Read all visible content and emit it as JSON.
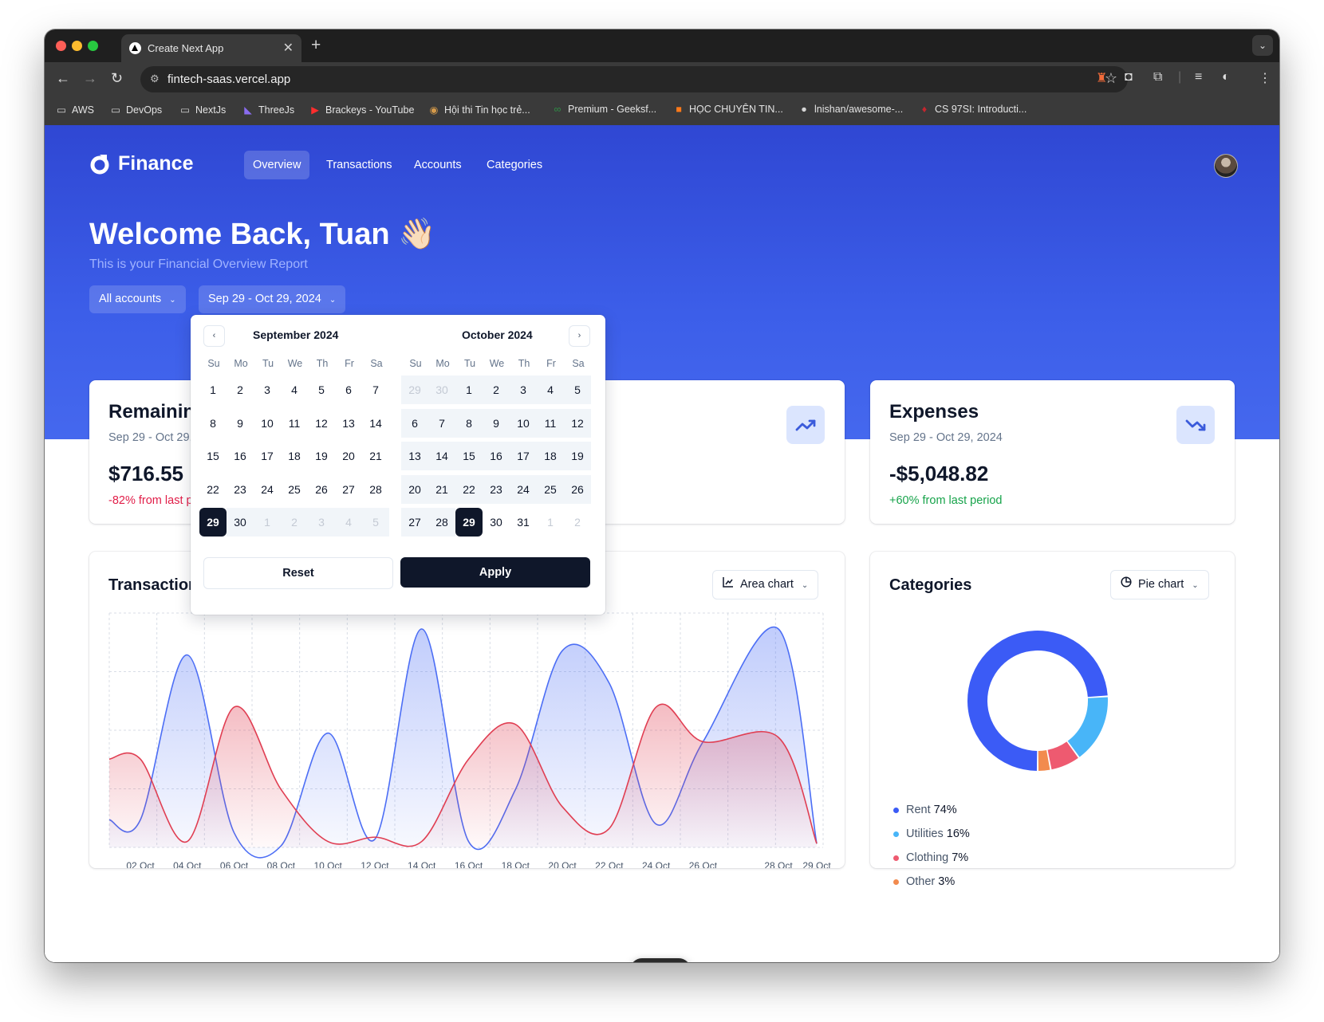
{
  "browser": {
    "tab_title": "Create Next App",
    "new_tab": "+",
    "url": "fintech-saas.vercel.app",
    "bookmarks": [
      "AWS",
      "DevOps",
      "NextJs",
      "ThreeJs",
      "Brackeys - YouTube",
      "Hội thi Tin học trẻ...",
      "Premium - Geeksf...",
      "HỌC CHUYÊN TIN...",
      "lnishan/awesome-...",
      "CS 97SI: Introducti..."
    ]
  },
  "header": {
    "logo": "Finance",
    "nav": [
      "Overview",
      "Transactions",
      "Accounts",
      "Categories"
    ],
    "active_nav": "Overview"
  },
  "hero": {
    "welcome": "Welcome Back, Tuan 👋🏻",
    "subtitle": "This is your Financial Overview Report",
    "account_filter": "All accounts",
    "date_filter": "Sep 29 - Oct 29, 2024"
  },
  "cards": {
    "remaining": {
      "title": "Remaining",
      "period": "Sep 29 - Oct 29, 2024",
      "amount": "$716.55",
      "change": "-82% from last period",
      "change_color": "#e11d48"
    },
    "expenses": {
      "title": "Expenses",
      "period": "Sep 29 - Oct 29, 2024",
      "amount": "-$5,048.82",
      "change": "+60% from last period",
      "change_color": "#16a34a"
    }
  },
  "transactions": {
    "title": "Transactions",
    "chart_select": "Area chart"
  },
  "categories_panel": {
    "title": "Categories",
    "chart_select": "Pie chart"
  },
  "calendar": {
    "month1": "September 2024",
    "month2": "October 2024",
    "weekdays": [
      "Su",
      "Mo",
      "Tu",
      "We",
      "Th",
      "Fr",
      "Sa"
    ],
    "reset": "Reset",
    "apply": "Apply",
    "sep_grid": [
      [
        "1",
        "2",
        "3",
        "4",
        "5",
        "6",
        "7"
      ],
      [
        "8",
        "9",
        "10",
        "11",
        "12",
        "13",
        "14"
      ],
      [
        "15",
        "16",
        "17",
        "18",
        "19",
        "20",
        "21"
      ],
      [
        "22",
        "23",
        "24",
        "25",
        "26",
        "27",
        "28"
      ],
      [
        "29",
        "30",
        "1",
        "2",
        "3",
        "4",
        "5"
      ]
    ],
    "oct_grid": [
      [
        "29",
        "30",
        "1",
        "2",
        "3",
        "4",
        "5"
      ],
      [
        "6",
        "7",
        "8",
        "9",
        "10",
        "11",
        "12"
      ],
      [
        "13",
        "14",
        "15",
        "16",
        "17",
        "18",
        "19"
      ],
      [
        "20",
        "21",
        "22",
        "23",
        "24",
        "25",
        "26"
      ],
      [
        "27",
        "28",
        "29",
        "30",
        "31",
        "1",
        "2"
      ]
    ]
  },
  "colors": {
    "income": "#3b5bdb",
    "expense": "#e03e52",
    "accent": "#3448d8"
  },
  "chart_data": [
    {
      "type": "area",
      "x": [
        "02 Oct",
        "04 Oct",
        "06 Oct",
        "08 Oct",
        "10 Oct",
        "12 Oct",
        "14 Oct",
        "16 Oct",
        "18 Oct",
        "20 Oct",
        "22 Oct",
        "24 Oct",
        "26 Oct",
        "28 Oct",
        "29 Oct"
      ],
      "series": [
        {
          "values": [
            12,
            88,
            6,
            0,
            52,
            3,
            100,
            2,
            26,
            90,
            75,
            10,
            48,
            100,
            1
          ],
          "color": "#4c6ef5"
        },
        {
          "values": [
            40,
            2,
            64,
            26,
            2,
            4,
            2,
            40,
            56,
            18,
            8,
            64,
            48,
            50,
            1
          ],
          "color": "#e03e52"
        }
      ]
    },
    {
      "type": "pie",
      "categories": [
        "Rent",
        "Utilities",
        "Clothing",
        "Other"
      ],
      "values": [
        74,
        16,
        7,
        3
      ],
      "colors": [
        "#3b5bf6",
        "#48b5f8",
        "#ee5a70",
        "#f28b4e"
      ]
    }
  ]
}
